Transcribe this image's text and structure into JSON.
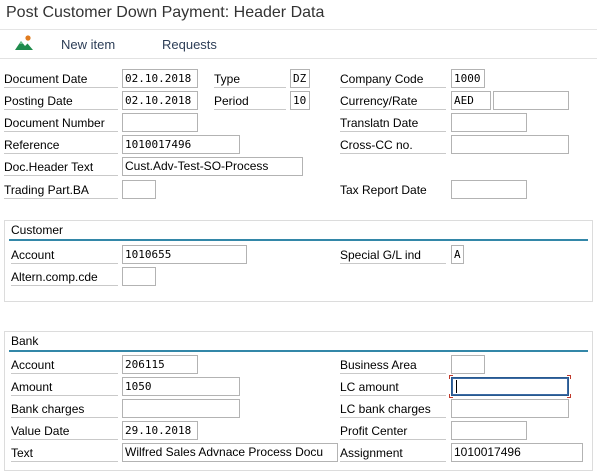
{
  "window": {
    "title": "Post Customer Down Payment: Header Data"
  },
  "toolbar": {
    "icon": "mountain-image-icon",
    "new_item": "New item",
    "requests": "Requests"
  },
  "header": {
    "document_date": {
      "label": "Document Date",
      "value": "02.10.2018"
    },
    "type": {
      "label": "Type",
      "value": "DZ"
    },
    "company_code": {
      "label": "Company Code",
      "value": "1000"
    },
    "posting_date": {
      "label": "Posting Date",
      "value": "02.10.2018"
    },
    "period": {
      "label": "Period",
      "value": "10"
    },
    "currency_rate": {
      "label": "Currency/Rate",
      "currency": "AED",
      "rate": ""
    },
    "document_number": {
      "label": "Document Number",
      "value": ""
    },
    "translation_date": {
      "label": "Translatn Date",
      "value": ""
    },
    "reference": {
      "label": "Reference",
      "value": "1010017496"
    },
    "cross_cc": {
      "label": "Cross-CC no.",
      "value": ""
    },
    "doc_header_text": {
      "label": "Doc.Header Text",
      "value": "Cust.Adv-Test-SO-Process"
    },
    "trading_part": {
      "label": "Trading Part.BA",
      "value": ""
    },
    "tax_report_date": {
      "label": "Tax Report Date",
      "value": ""
    }
  },
  "customer": {
    "title": "Customer",
    "account": {
      "label": "Account",
      "value": "1010655"
    },
    "special_gl": {
      "label": "Special G/L ind",
      "value": "A"
    },
    "altern_comp": {
      "label": "Altern.comp.cde",
      "value": ""
    }
  },
  "bank": {
    "title": "Bank",
    "account": {
      "label": "Account",
      "value": "206115"
    },
    "business_area": {
      "label": "Business Area",
      "value": ""
    },
    "amount": {
      "label": "Amount",
      "value": "1050"
    },
    "lc_amount": {
      "label": "LC amount",
      "value": ""
    },
    "bank_charges": {
      "label": "Bank charges",
      "value": ""
    },
    "lc_bank_charges": {
      "label": "LC bank charges",
      "value": ""
    },
    "value_date": {
      "label": "Value Date",
      "value": "29.10.2018"
    },
    "profit_center": {
      "label": "Profit Center",
      "value": ""
    },
    "text": {
      "label": "Text",
      "value": "Wilfred Sales Advnace Process Docu"
    },
    "assignment": {
      "label": "Assignment",
      "value": "1010017496"
    }
  }
}
